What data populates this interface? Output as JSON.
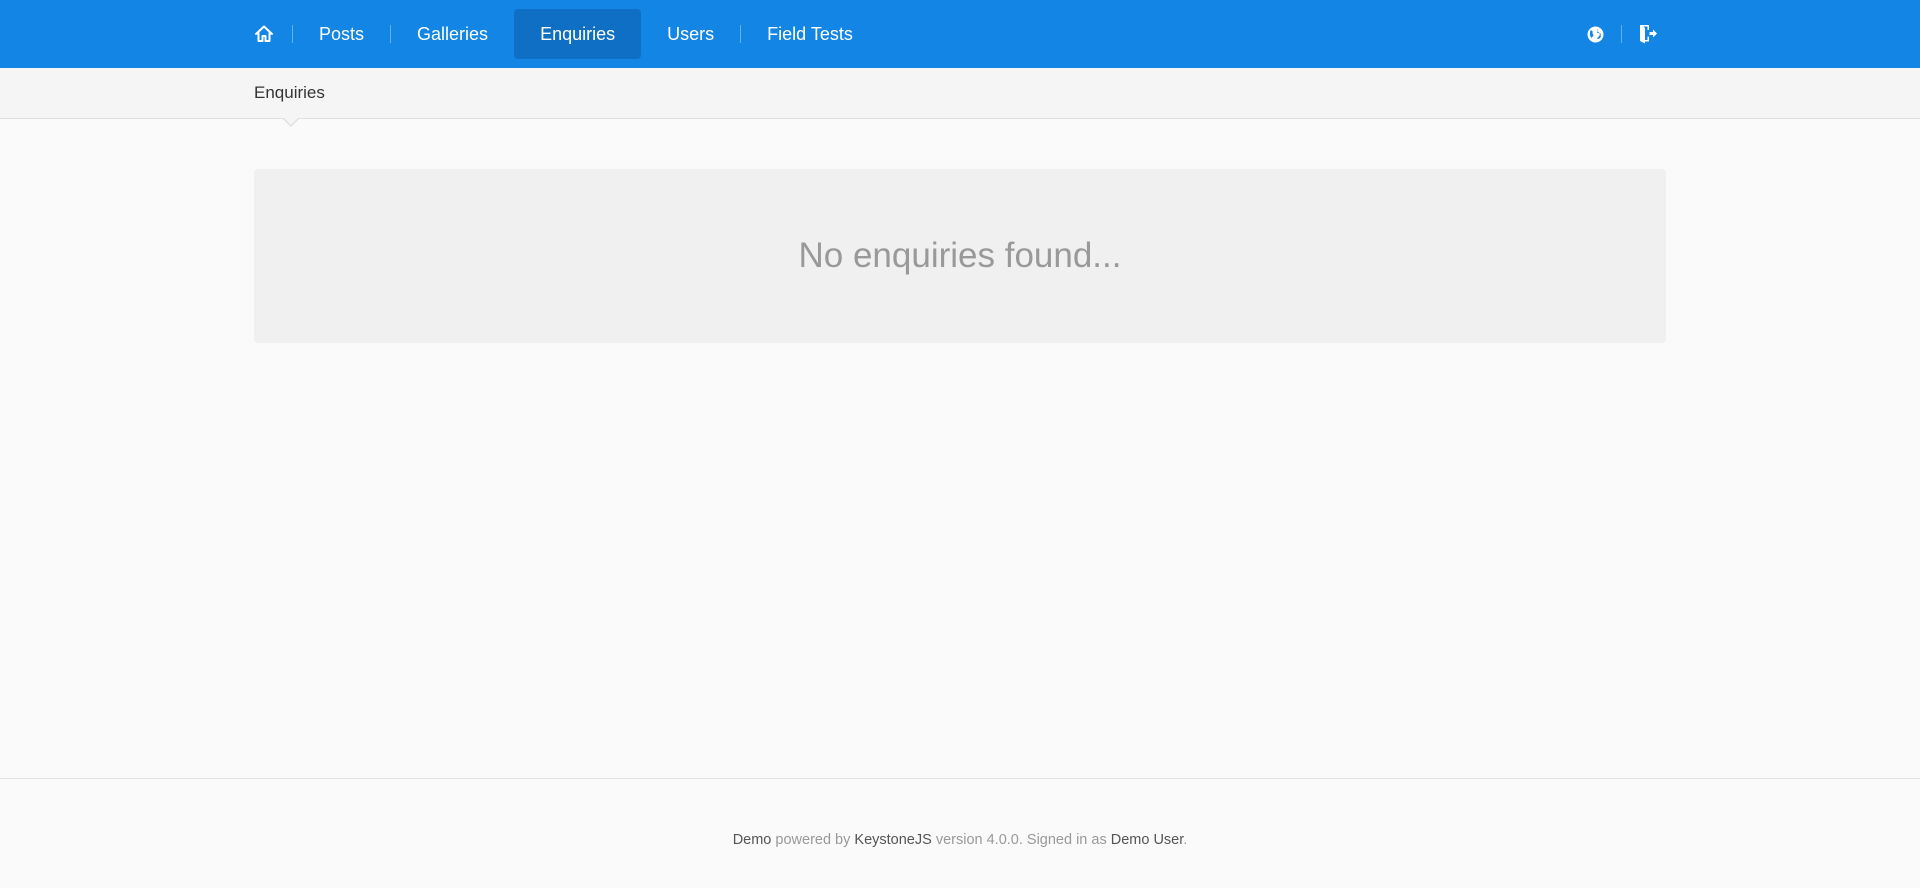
{
  "nav": {
    "home_icon": "home-icon",
    "items": [
      {
        "label": "Posts",
        "active": false
      },
      {
        "label": "Galleries",
        "active": false
      },
      {
        "label": "Enquiries",
        "active": true
      },
      {
        "label": "Users",
        "active": false
      },
      {
        "label": "Field Tests",
        "active": false
      }
    ],
    "right_icons": [
      "globe-icon",
      "sign-out-icon"
    ]
  },
  "subnav": {
    "current": "Enquiries"
  },
  "main": {
    "empty_message": "No enquiries found..."
  },
  "footer": {
    "brand": "Demo",
    "powered_by": "powered by",
    "framework": "KeystoneJS",
    "version_text": "version 4.0.0. Signed in as",
    "user": "Demo User",
    "end": "."
  },
  "colors": {
    "navbar": "#1385e5",
    "navbar_active": "#0f6fc4",
    "background": "#fafafa"
  }
}
